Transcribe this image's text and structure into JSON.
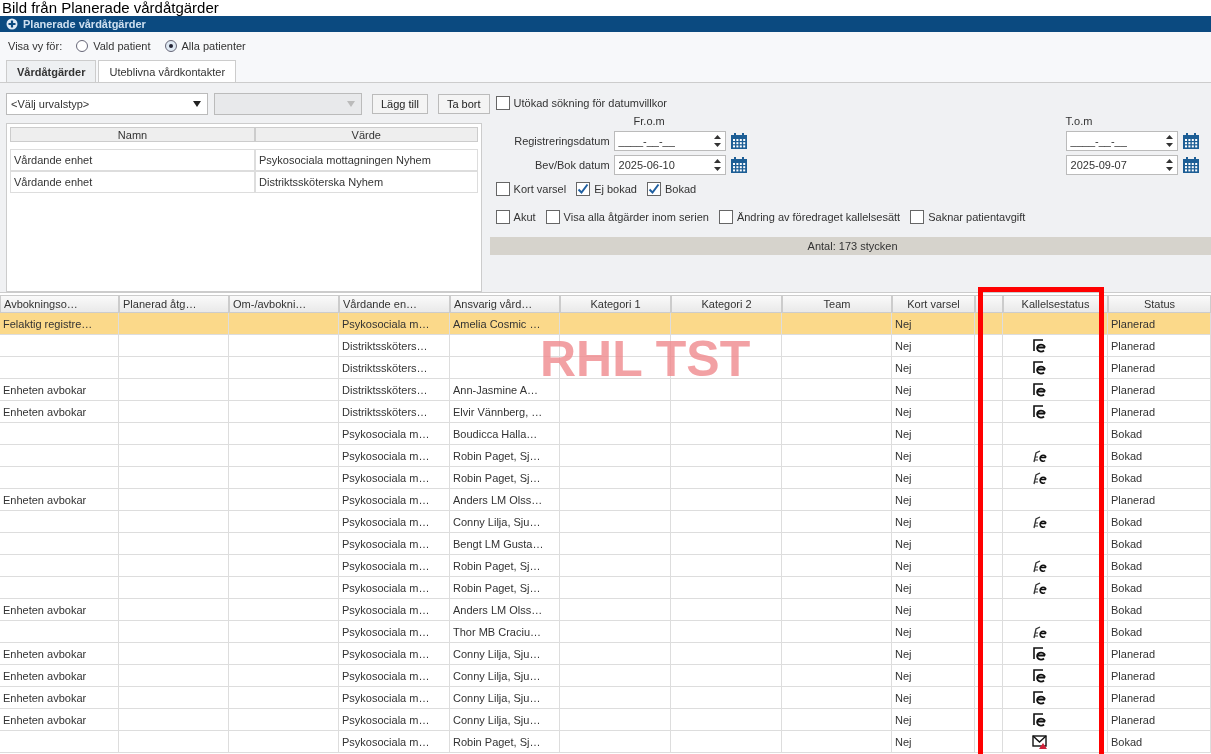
{
  "caption": "Bild från Planerade vårdåtgärder",
  "window": {
    "title": "Planerade vårdåtgärder"
  },
  "view_for": {
    "label": "Visa vy för:",
    "options": [
      {
        "label": "Vald patient",
        "selected": false
      },
      {
        "label": "Alla patienter",
        "selected": true
      }
    ]
  },
  "tabs": [
    {
      "label": "Vårdåtgärder",
      "selected": true
    },
    {
      "label": "Uteblivna vårdkontakter",
      "selected": false
    }
  ],
  "selection": {
    "type_dropdown": {
      "value": "<Välj urvalstyp>"
    },
    "value_dropdown": {
      "disabled": true
    },
    "buttons": [
      "Lägg till",
      "Ta bort"
    ]
  },
  "filter_table": {
    "columns": [
      "Namn",
      "Värde"
    ],
    "rows": [
      {
        "name": "Vårdande enhet",
        "value": "Psykosociala mottagningen Nyhem"
      },
      {
        "name": "Vårdande enhet",
        "value": "Distriktssköterska Nyhem"
      }
    ]
  },
  "date_filters": {
    "extended": {
      "label": "Utökad sökning för datumvillkor",
      "checked": false
    },
    "from_label": "Fr.o.m",
    "to_label": "T.o.m",
    "rows": [
      {
        "label": "Registreringsdatum",
        "from": "____-__-__",
        "to": "____-__-__"
      },
      {
        "label": "Bev/Bok datum",
        "from": "2025-06-10",
        "to": "2025-09-07"
      }
    ]
  },
  "checkbox_rows": [
    [
      {
        "label": "Kort varsel",
        "checked": false
      },
      {
        "label": "Ej bokad",
        "checked": true
      },
      {
        "label": "Bokad",
        "checked": true
      }
    ],
    [
      {
        "label": "Akut",
        "checked": false
      },
      {
        "label": "Visa alla åtgärder inom serien",
        "checked": false
      },
      {
        "label": "Ändring av föredraget kallelsesätt",
        "checked": false
      },
      {
        "label": "Saknar patientavgift",
        "checked": false
      }
    ]
  ],
  "count": "Antal: 173 stycken",
  "watermark": "RHL TST",
  "grid": {
    "columns": [
      {
        "kind": "text",
        "label": "Avbokningso…"
      },
      {
        "kind": "text",
        "label": "Planerad åtg…"
      },
      {
        "kind": "text",
        "label": "Om-/avbokni…"
      },
      {
        "kind": "text",
        "label": "Vårdande en…"
      },
      {
        "kind": "text",
        "label": "Ansvarig vård…"
      },
      {
        "kind": "text",
        "label": "Kategori 1"
      },
      {
        "kind": "text",
        "label": "Kategori 2"
      },
      {
        "kind": "text",
        "label": "Team"
      },
      {
        "kind": "text",
        "label": "Kort varsel"
      },
      {
        "kind": "blank"
      },
      {
        "kind": "text",
        "label": "Kallelsestatus"
      },
      {
        "kind": "text",
        "label": "Status"
      }
    ],
    "rows": [
      {
        "selected": true,
        "cancel_reason": "Felaktig registre…",
        "unit": "Psykosociala m…",
        "responsible": "Amelia Cosmic …",
        "short_notice": "Nej",
        "status": "Planerad"
      },
      {
        "selected": false,
        "unit": "Distriktssköters…",
        "short_notice": "Nej",
        "call_icon": {
          "kind": "letter"
        },
        "status": "Planerad"
      },
      {
        "selected": false,
        "unit": "Distriktssköters…",
        "short_notice": "Nej",
        "call_icon": {
          "kind": "letter"
        },
        "status": "Planerad"
      },
      {
        "selected": false,
        "cancel_reason": "Enheten avbokar",
        "unit": "Distriktssköters…",
        "responsible": "Ann-Jasmine A…",
        "short_notice": "Nej",
        "call_icon": {
          "kind": "letter"
        },
        "status": "Planerad"
      },
      {
        "selected": false,
        "cancel_reason": "Enheten avbokar",
        "unit": "Distriktssköters…",
        "responsible": "Elvir Vännberg, …",
        "short_notice": "Nej",
        "call_icon": {
          "kind": "letter"
        },
        "status": "Planerad"
      },
      {
        "selected": false,
        "unit": "Psykosociala m…",
        "responsible": "Boudicca Halla…",
        "short_notice": "Nej",
        "status": "Bokad"
      },
      {
        "selected": false,
        "unit": "Psykosociala m…",
        "responsible": "Robin Paget, Sj…",
        "short_notice": "Nej",
        "call_icon": {
          "kind": "sent"
        },
        "status": "Bokad"
      },
      {
        "selected": false,
        "unit": "Psykosociala m…",
        "responsible": "Robin Paget, Sj…",
        "short_notice": "Nej",
        "call_icon": {
          "kind": "sent"
        },
        "status": "Bokad"
      },
      {
        "selected": false,
        "cancel_reason": "Enheten avbokar",
        "unit": "Psykosociala m…",
        "responsible": "Anders LM Olss…",
        "short_notice": "Nej",
        "status": "Planerad"
      },
      {
        "selected": false,
        "unit": "Psykosociala m…",
        "responsible": "Conny Lilja, Sju…",
        "short_notice": "Nej",
        "call_icon": {
          "kind": "sent"
        },
        "status": "Bokad"
      },
      {
        "selected": false,
        "unit": "Psykosociala m…",
        "responsible": "Bengt LM Gusta…",
        "short_notice": "Nej",
        "status": "Bokad"
      },
      {
        "selected": false,
        "unit": "Psykosociala m…",
        "responsible": "Robin Paget, Sj…",
        "short_notice": "Nej",
        "call_icon": {
          "kind": "sent"
        },
        "status": "Bokad"
      },
      {
        "selected": false,
        "unit": "Psykosociala m…",
        "responsible": "Robin Paget, Sj…",
        "short_notice": "Nej",
        "call_icon": {
          "kind": "sent"
        },
        "status": "Bokad"
      },
      {
        "selected": false,
        "cancel_reason": "Enheten avbokar",
        "unit": "Psykosociala m…",
        "responsible": "Anders LM Olss…",
        "short_notice": "Nej",
        "status": "Bokad"
      },
      {
        "selected": false,
        "unit": "Psykosociala m…",
        "responsible": "Thor MB Craciu…",
        "short_notice": "Nej",
        "call_icon": {
          "kind": "sent"
        },
        "status": "Bokad"
      },
      {
        "selected": false,
        "cancel_reason": "Enheten avbokar",
        "unit": "Psykosociala m…",
        "responsible": "Conny Lilja, Sju…",
        "short_notice": "Nej",
        "call_icon": {
          "kind": "letter"
        },
        "status": "Planerad"
      },
      {
        "selected": false,
        "cancel_reason": "Enheten avbokar",
        "unit": "Psykosociala m…",
        "responsible": "Conny Lilja, Sju…",
        "short_notice": "Nej",
        "call_icon": {
          "kind": "letter"
        },
        "status": "Planerad"
      },
      {
        "selected": false,
        "cancel_reason": "Enheten avbokar",
        "unit": "Psykosociala m…",
        "responsible": "Conny Lilja, Sju…",
        "short_notice": "Nej",
        "call_icon": {
          "kind": "letter"
        },
        "status": "Planerad"
      },
      {
        "selected": false,
        "cancel_reason": "Enheten avbokar",
        "unit": "Psykosociala m…",
        "responsible": "Conny Lilja, Sju…",
        "short_notice": "Nej",
        "call_icon": {
          "kind": "letter"
        },
        "status": "Planerad"
      },
      {
        "selected": false,
        "unit": "Psykosociala m…",
        "responsible": "Robin Paget, Sj…",
        "short_notice": "Nej",
        "call_icon": {
          "kind": "mail_warning"
        },
        "status": "Bokad"
      }
    ]
  }
}
